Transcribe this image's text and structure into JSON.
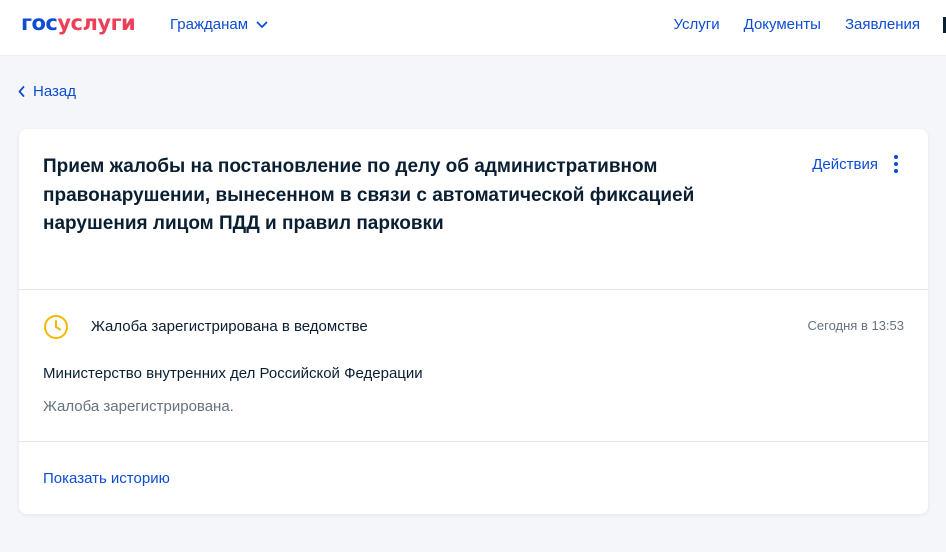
{
  "header": {
    "logo_part1": "гос",
    "logo_part2": "услуги",
    "audience_menu": "Гражданам",
    "nav": [
      "Услуги",
      "Документы",
      "Заявления"
    ]
  },
  "back_label": "Назад",
  "card": {
    "title": "Прием жалобы на постановление по делу об административном правонарушении, вынесенном в связи с автоматической фиксацией нарушения лицом ПДД и правил парковки",
    "actions_label": "Действия",
    "status": {
      "text": "Жалоба зарегистрирована в ведомстве",
      "time": "Сегодня в 13:53",
      "icon": "clock-icon"
    },
    "organization": "Министерство внутренних дел Российской Федерации",
    "status_description": "Жалоба зарегистрирована.",
    "history_link": "Показать историю"
  },
  "colors": {
    "brand_blue": "#0d4cd3",
    "brand_red": "#ee3f58",
    "status_yellow": "#f5b800",
    "background": "#f4f6fa"
  }
}
